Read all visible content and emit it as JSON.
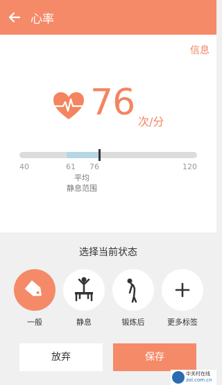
{
  "header": {
    "title": "心率"
  },
  "info_label": "信息",
  "measurement": {
    "value": "76",
    "unit": "次/分"
  },
  "scale": {
    "min_label": "40",
    "max_label": "120",
    "resting_low_label": "61",
    "current_label": "76",
    "average_label": "平均",
    "resting_range_label": "静息范围"
  },
  "status": {
    "prompt": "选择当前状态",
    "options": [
      {
        "label": "一般",
        "icon": "tag-icon",
        "selected": true
      },
      {
        "label": "静息",
        "icon": "resting-person-icon",
        "selected": false
      },
      {
        "label": "锻炼后",
        "icon": "bending-person-icon",
        "selected": false
      },
      {
        "label": "更多标签",
        "icon": "plus-icon",
        "selected": false
      }
    ]
  },
  "actions": {
    "cancel_label": "放弃",
    "save_label": "保存"
  },
  "watermark": {
    "line1": "中关村在线",
    "line2": "zol.com.cn"
  },
  "colors": {
    "accent": "#f58a68",
    "range": "#b7d6e3",
    "track": "#dcdcdc"
  }
}
